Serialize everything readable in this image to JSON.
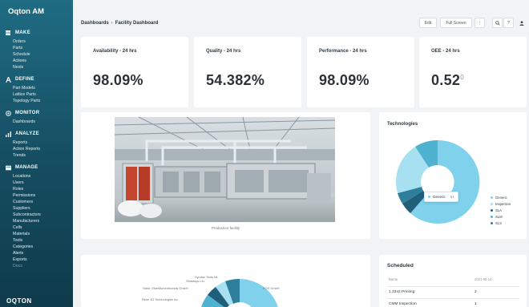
{
  "brand": "Oqton AM",
  "footer_logo": "OQTON",
  "sidebar": {
    "sections": [
      {
        "title": "MAKE",
        "icon": "grid-icon",
        "items": [
          "Orders",
          "Parts",
          "Schedule",
          "Actions",
          "Nests"
        ]
      },
      {
        "title": "DEFINE",
        "icon": "a-letter-icon",
        "items": [
          "Part Models",
          "Lattice Parts",
          "Topology Parts"
        ]
      },
      {
        "title": "MONITOR",
        "icon": "monitor-icon",
        "items": [
          "Dashboards"
        ]
      },
      {
        "title": "ANALYZE",
        "icon": "bar-chart-icon",
        "items": [
          "Reports",
          "Action Reports",
          "Trends"
        ]
      },
      {
        "title": "MANAGE",
        "icon": "folder-icon",
        "items": [
          "Locations",
          "Users",
          "Roles",
          "Permissions",
          "Customers",
          "Suppliers",
          "Subcontractors",
          "Manufacturers",
          "Cells",
          "Materials",
          "Tools",
          "Categories",
          "Alerts",
          "Exports",
          "Docs"
        ]
      }
    ]
  },
  "header": {
    "breadcrumb_root": "Dashboards",
    "breadcrumb_separator": "›",
    "breadcrumb_current": "Facility Dashboard",
    "edit_label": "Edit",
    "fullscreen_label": "Full Screen",
    "more_label": "⋮",
    "search_icon": "search-icon",
    "help_label": "?",
    "user_icon": "user-icon"
  },
  "kpis": [
    {
      "title": "Availability - 24 hrs",
      "value": "98.09%",
      "suffix": ""
    },
    {
      "title": "Quality - 24 hrs",
      "value": "54.382%",
      "suffix": ""
    },
    {
      "title": "Performance - 24 hrs",
      "value": "98.09%",
      "suffix": ""
    },
    {
      "title": "OEE - 24 hrs",
      "value": "0.52",
      "suffix": "0"
    }
  ],
  "photo": {
    "caption": "Production facility"
  },
  "technologies": {
    "title": "Technologies",
    "tooltip": {
      "label": "Generic",
      "value": "51"
    },
    "legend": [
      {
        "label": "Generic",
        "color": "#7fd1ec"
      },
      {
        "label": "Inspection",
        "color": "#a7e0f0"
      },
      {
        "label": "SLA",
        "color": "#1f5f7a"
      },
      {
        "label": "SLM",
        "color": "#4fb2d0"
      },
      {
        "label": "SLS",
        "color": "#2e7f9c"
      }
    ]
  },
  "manufacturers": {
    "labels": [
      "Syndax Tools NL",
      "Stratasys Ltd.",
      "Sisler Oberflächentechnik GmbH",
      "Rese 3D Technologies Inc.",
      "EOS GmbH"
    ]
  },
  "scheduled": {
    "title": "Scheduled",
    "col_name": "Name",
    "col_date": "2021-05-14",
    "rows": [
      {
        "name": "1.3342 Printing",
        "value": "2"
      },
      {
        "name": "CMM Inspection",
        "value": "1"
      }
    ]
  },
  "colors": {
    "sidebar_top": "#1f6c83",
    "sidebar_bottom": "#0f3b4c",
    "donut_main": "#7fd1ec"
  }
}
